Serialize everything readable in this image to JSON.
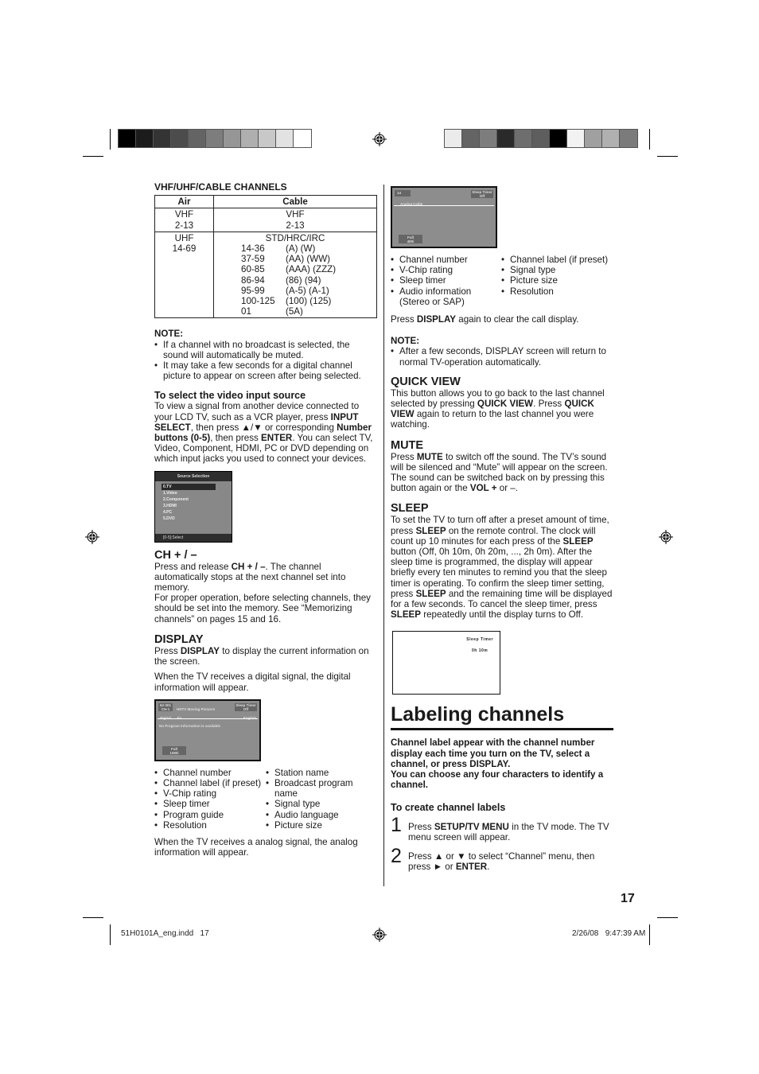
{
  "colorbars": {
    "left": [
      "#000000",
      "#1c1c1c",
      "#343434",
      "#4c4c4c",
      "#646464",
      "#7d7d7d",
      "#969696",
      "#afafaf",
      "#c8c8c8",
      "#e2e2e2",
      "#ffffff"
    ],
    "right": [
      "#ebebeb",
      "#646464",
      "#7d7d7d",
      "#2a2a2a",
      "#6e6e6e",
      "#5e5e5e",
      "#000000",
      "#f2f2f2",
      "#a0a0a0",
      "#b0b0b0",
      "#7b7b7b"
    ]
  },
  "channels": {
    "title": "VHF/UHF/CABLE CHANNELS",
    "headers": [
      "Air",
      "Cable"
    ],
    "rows": [
      {
        "air": [
          "VHF",
          "2-13"
        ],
        "cable_head": "VHF",
        "cable_sub": "2-13",
        "ranges": []
      },
      {
        "air": [
          "UHF",
          "14-69"
        ],
        "cable_head": "STD/HRC/IRC",
        "cable_sub": "",
        "ranges": [
          [
            "14-36",
            "(A) (W)"
          ],
          [
            "37-59",
            "(AA) (WW)"
          ],
          [
            "60-85",
            "(AAA) (ZZZ)"
          ],
          [
            "86-94",
            "(86) (94)"
          ],
          [
            "95-99",
            "(A-5) (A-1)"
          ],
          [
            "100-125",
            "(100) (125)"
          ],
          [
            "01",
            "(5A)"
          ]
        ]
      }
    ]
  },
  "note1": {
    "title": "NOTE:",
    "items": [
      "If a channel with no broadcast is selected, the sound will automatically be muted.",
      "It may take a few seconds for a digital channel picture to appear on screen after being selected."
    ]
  },
  "video_input": {
    "title": "To select the video input source",
    "body_html_parts": [
      "To view a signal from another device connected to your LCD TV, such as a VCR player, press ",
      "INPUT SELECT",
      ", then press ▲/▼ or corresponding ",
      "Number buttons (0-5)",
      ", then press ",
      "ENTER",
      ". You can select TV, Video, Component, HDMI, PC or DVD depending on which input jacks you used to connect your devices."
    ]
  },
  "source_screen": {
    "header": "Source Selection",
    "items": [
      "0.TV",
      "1.Video",
      "2.Component",
      "3.HDMI",
      "4.PC",
      "5.DVD"
    ],
    "selected_index": 0,
    "footer": "[0-5]:Select"
  },
  "ch": {
    "title": "CH + / –",
    "p1": [
      "Press and release ",
      "CH + / –",
      ". The channel automatically stops at the next channel set into memory."
    ],
    "p2": "For proper operation, before selecting channels, they should be set into the memory. See “Memorizing channels” on pages 15 and 16."
  },
  "display": {
    "title": "DISPLAY",
    "p1": [
      "Press ",
      "DISPLAY",
      " to display the current information on the screen."
    ],
    "p2": "When the TV receives a digital signal, the digital information will appear."
  },
  "digital_screen": {
    "channel": "62-301",
    "channel_sub": "CH-1",
    "program": "HDTV Moving Picture1",
    "signal": "Digital",
    "source": "Air",
    "sleep": "Sleep Timer",
    "sleep_val": "Off",
    "audio": "English",
    "info": "No Program Information is available",
    "picture": "Full",
    "resolution": "1080i"
  },
  "digital_list": {
    "col1": [
      "Channel number",
      "Channel label (if preset)",
      "V-Chip rating",
      "Sleep timer",
      "Program guide",
      "Resolution"
    ],
    "col2": [
      "Station name",
      "Broadcast program name",
      "Signal type",
      "Audio language",
      "Picture size"
    ]
  },
  "analog_intro": "When the TV receives a analog signal, the analog information will appear.",
  "analog_screen": {
    "channel": "14",
    "signal": "Analog",
    "source": "Cable",
    "sleep": "Sleep Timer",
    "sleep_val": "Off",
    "picture": "Full",
    "resolution": "480i"
  },
  "analog_list": {
    "col1": [
      "Channel number",
      "V-Chip rating",
      "Sleep timer",
      "Audio information (Stereo or SAP)"
    ],
    "col2": [
      "Channel label (if preset)",
      "Signal type",
      "Picture size",
      "Resolution"
    ]
  },
  "display_clear": [
    "Press ",
    "DISPLAY",
    " again to clear the call display."
  ],
  "note2": {
    "title": "NOTE:",
    "items": [
      "After a few seconds, DISPLAY screen will return to normal TV-operation automatically."
    ]
  },
  "quick_view": {
    "title": "QUICK VIEW",
    "parts": [
      "This button allows you to go back to the last channel selected by pressing ",
      "QUICK VIEW",
      ". Press ",
      "QUICK VIEW",
      " again to return to the last channel you were watching."
    ]
  },
  "mute": {
    "title": "MUTE",
    "parts": [
      "Press ",
      "MUTE",
      " to switch off the sound. The TV’s sound will be silenced and “Mute” will appear on the screen. The sound can be switched back on by pressing this button again or the ",
      "VOL +",
      " or –."
    ]
  },
  "sleep": {
    "title": "SLEEP",
    "parts": [
      "To set the TV to turn off after a preset amount of time, press ",
      "SLEEP",
      " on the remote control. The clock will count up 10 minutes for each press of the ",
      "SLEEP",
      " button (Off, 0h 10m, 0h 20m, ..., 2h 0m). After the sleep time is programmed, the display will appear briefly every ten minutes to remind you that the sleep timer is operating. To confirm the sleep timer setting, press ",
      "SLEEP",
      " and the remaining time will be displayed for a few seconds. To cancel the sleep timer, press ",
      "SLEEP",
      " repeatedly until the display turns to Off."
    ]
  },
  "sleep_screen": {
    "label": "Sleep Timer",
    "value": "0h 10m"
  },
  "labeling": {
    "title": "Labeling channels",
    "lead1": "Channel label appear with the channel number display each time you turn on the TV, select a channel, or press DISPLAY.",
    "lead2": "You can choose any four characters to identify a channel.",
    "subtitle": "To create channel labels",
    "steps": [
      {
        "num": "1",
        "parts": [
          "Press ",
          "SETUP/TV MENU",
          " in the TV mode. The TV menu screen will appear."
        ]
      },
      {
        "num": "2",
        "parts": [
          "Press ▲ or ▼ to select “Channel” menu, then press ► or ",
          "ENTER",
          "."
        ]
      }
    ]
  },
  "page_number": "17",
  "slug": {
    "file": "51H0101A_eng.indd   17",
    "date": "2/26/08   9:47:39 AM"
  }
}
